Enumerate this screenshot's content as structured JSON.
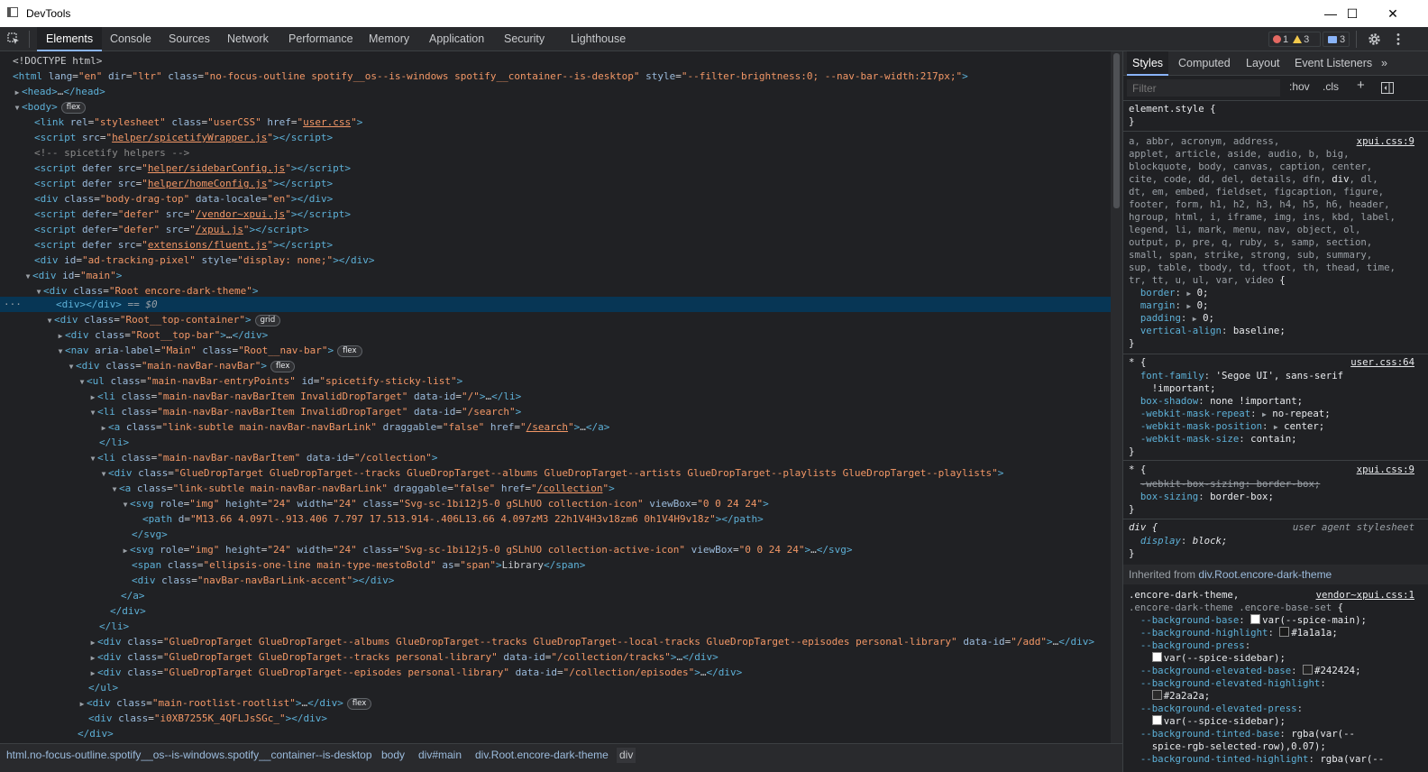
{
  "window": {
    "title": "DevTools",
    "minimize": "—",
    "maximize": "☐",
    "close": "✕"
  },
  "toolbar": {
    "tabs": [
      "Elements",
      "Console",
      "Sources",
      "Network",
      "Performance",
      "Memory",
      "Application",
      "Security",
      "Lighthouse"
    ],
    "errors": "1",
    "warnings": "3",
    "messages": "3"
  },
  "dom": {
    "selected_marker": "== $0"
  },
  "breadcrumb": [
    "html.no-focus-outline.spotify__os--is-windows.spotify__container--is-desktop",
    "body",
    "div#main",
    "div.Root.encore-dark-theme",
    "div"
  ],
  "styles": {
    "tabs": [
      "Styles",
      "Computed",
      "Layout",
      "Event Listeners"
    ],
    "more": "»",
    "filter_placeholder": "Filter",
    "hov": ":hov",
    "cls": ".cls",
    "plus": "+",
    "inherited_label": "Inherited from",
    "inherited_from": "div.Root.encore-dark-theme"
  },
  "colors": {
    "accent": "#8ab4f8",
    "selected_row": "#073655",
    "tag": "#5db0d7",
    "attr_value": "#f29766"
  }
}
